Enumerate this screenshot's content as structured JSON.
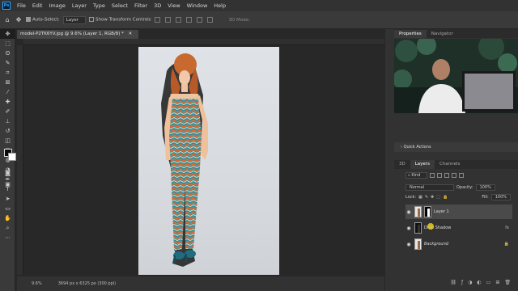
{
  "menubar": {
    "logo": "Ps",
    "items": [
      "File",
      "Edit",
      "Image",
      "Layer",
      "Type",
      "Select",
      "Filter",
      "3D",
      "View",
      "Window",
      "Help"
    ]
  },
  "options": {
    "auto_select_label": "Auto-Select:",
    "auto_select_value": "Layer",
    "transform_label": "Show Transform Controls",
    "mode3d_label": "3D Mode:"
  },
  "document": {
    "tab_title": "model-P2TK6YV.jpg @ 9.6% (Layer 1, RGB/8) *",
    "zoom": "9.6%",
    "dimensions": "3694 px x 6325 px (300 ppi)"
  },
  "panels": {
    "properties_tab": "Properties",
    "navigator_tab": "Navigator",
    "quick_actions": "Quick Actions",
    "tab_3d": "3D",
    "tab_layers": "Layers",
    "tab_channels": "Channels"
  },
  "layers": {
    "kind_label": "Kind",
    "blend_mode": "Normal",
    "opacity_label": "Opacity:",
    "opacity_value": "100%",
    "lock_label": "Lock:",
    "fill_label": "Fill:",
    "fill_value": "100%",
    "items": [
      {
        "name": "Layer 1"
      },
      {
        "name": "Drop Shadow",
        "fx": "fx"
      },
      {
        "name": "Background"
      }
    ]
  },
  "colors": {
    "accent": "#31a8ff",
    "panel_bg": "#323232",
    "canvas_bg": "#282828",
    "cursor_highlight": "#e6cc30"
  }
}
